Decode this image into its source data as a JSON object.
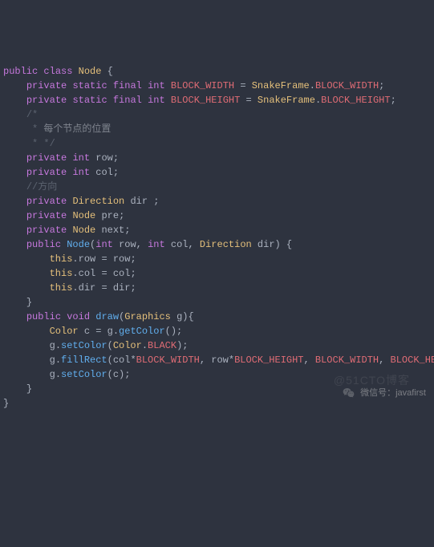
{
  "code": {
    "tokens": [
      [
        [
          "kw-public",
          "public"
        ],
        [
          "space",
          " "
        ],
        [
          "kw-class",
          "class"
        ],
        [
          "space",
          " "
        ],
        [
          "class-name",
          "Node"
        ],
        [
          "space",
          " "
        ],
        [
          "punct",
          "{"
        ]
      ],
      [
        [
          "space",
          ""
        ]
      ],
      [
        [
          "indent",
          "    "
        ],
        [
          "kw-private",
          "private"
        ],
        [
          "space",
          " "
        ],
        [
          "kw-static",
          "static"
        ],
        [
          "space",
          " "
        ],
        [
          "kw-final",
          "final"
        ],
        [
          "space",
          " "
        ],
        [
          "kw-int",
          "int"
        ],
        [
          "space",
          " "
        ],
        [
          "field-name",
          "BLOCK_WIDTH"
        ],
        [
          "space",
          " "
        ],
        [
          "punct",
          "="
        ],
        [
          "space",
          " "
        ],
        [
          "class-name",
          "SnakeFrame"
        ],
        [
          "punct",
          "."
        ],
        [
          "field-name",
          "BLOCK_WIDTH"
        ],
        [
          "punct",
          ";"
        ]
      ],
      [
        [
          "indent",
          "    "
        ],
        [
          "kw-private",
          "private"
        ],
        [
          "space",
          " "
        ],
        [
          "kw-static",
          "static"
        ],
        [
          "space",
          " "
        ],
        [
          "kw-final",
          "final"
        ],
        [
          "space",
          " "
        ],
        [
          "kw-int",
          "int"
        ],
        [
          "space",
          " "
        ],
        [
          "field-name",
          "BLOCK_HEIGHT"
        ],
        [
          "space",
          " "
        ],
        [
          "punct",
          "="
        ],
        [
          "space",
          " "
        ],
        [
          "class-name",
          "SnakeFrame"
        ],
        [
          "punct",
          "."
        ],
        [
          "field-name",
          "BLOCK_HEIGHT"
        ],
        [
          "punct",
          ";"
        ]
      ],
      [
        [
          "indent",
          "    "
        ],
        [
          "comment",
          "/*"
        ]
      ],
      [
        [
          "indent",
          "     "
        ],
        [
          "comment",
          "* "
        ],
        [
          "comment-cn",
          "每个节点的位置"
        ]
      ],
      [
        [
          "indent",
          "     "
        ],
        [
          "comment",
          "* */"
        ]
      ],
      [
        [
          "indent",
          "    "
        ],
        [
          "kw-private",
          "private"
        ],
        [
          "space",
          " "
        ],
        [
          "kw-int",
          "int"
        ],
        [
          "space",
          " "
        ],
        [
          "ident",
          "row"
        ],
        [
          "punct",
          ";"
        ]
      ],
      [
        [
          "indent",
          "    "
        ],
        [
          "kw-private",
          "private"
        ],
        [
          "space",
          " "
        ],
        [
          "kw-int",
          "int"
        ],
        [
          "space",
          " "
        ],
        [
          "ident",
          "col"
        ],
        [
          "punct",
          ";"
        ]
      ],
      [
        [
          "indent",
          "    "
        ],
        [
          "comment",
          "//方向"
        ]
      ],
      [
        [
          "indent",
          "    "
        ],
        [
          "kw-private",
          "private"
        ],
        [
          "space",
          " "
        ],
        [
          "class-name",
          "Direction"
        ],
        [
          "space",
          " "
        ],
        [
          "ident",
          "dir "
        ],
        [
          "punct",
          ";"
        ]
      ],
      [
        [
          "space",
          ""
        ]
      ],
      [
        [
          "indent",
          "    "
        ],
        [
          "kw-private",
          "private"
        ],
        [
          "space",
          " "
        ],
        [
          "class-name",
          "Node"
        ],
        [
          "space",
          " "
        ],
        [
          "ident",
          "pre"
        ],
        [
          "punct",
          ";"
        ]
      ],
      [
        [
          "indent",
          "    "
        ],
        [
          "kw-private",
          "private"
        ],
        [
          "space",
          " "
        ],
        [
          "class-name",
          "Node"
        ],
        [
          "space",
          " "
        ],
        [
          "ident",
          "next"
        ],
        [
          "punct",
          ";"
        ]
      ],
      [
        [
          "space",
          ""
        ]
      ],
      [
        [
          "indent",
          "    "
        ],
        [
          "kw-public",
          "public"
        ],
        [
          "space",
          " "
        ],
        [
          "method-name",
          "Node"
        ],
        [
          "punct",
          "("
        ],
        [
          "kw-int",
          "int"
        ],
        [
          "space",
          " "
        ],
        [
          "ident",
          "row"
        ],
        [
          "punct",
          ", "
        ],
        [
          "kw-int",
          "int"
        ],
        [
          "space",
          " "
        ],
        [
          "ident",
          "col"
        ],
        [
          "punct",
          ", "
        ],
        [
          "class-name",
          "Direction"
        ],
        [
          "space",
          " "
        ],
        [
          "ident",
          "dir"
        ],
        [
          "punct",
          ") {"
        ]
      ],
      [
        [
          "indent",
          "        "
        ],
        [
          "kw-this",
          "this"
        ],
        [
          "punct",
          "."
        ],
        [
          "ident",
          "row"
        ],
        [
          "space",
          " "
        ],
        [
          "punct",
          "="
        ],
        [
          "space",
          " "
        ],
        [
          "ident",
          "row"
        ],
        [
          "punct",
          ";"
        ]
      ],
      [
        [
          "indent",
          "        "
        ],
        [
          "kw-this",
          "this"
        ],
        [
          "punct",
          "."
        ],
        [
          "ident",
          "col"
        ],
        [
          "space",
          " "
        ],
        [
          "punct",
          "="
        ],
        [
          "space",
          " "
        ],
        [
          "ident",
          "col"
        ],
        [
          "punct",
          ";"
        ]
      ],
      [
        [
          "indent",
          "        "
        ],
        [
          "kw-this",
          "this"
        ],
        [
          "punct",
          "."
        ],
        [
          "ident",
          "dir"
        ],
        [
          "space",
          " "
        ],
        [
          "punct",
          "="
        ],
        [
          "space",
          " "
        ],
        [
          "ident",
          "dir"
        ],
        [
          "punct",
          ";"
        ]
      ],
      [
        [
          "indent",
          "    "
        ],
        [
          "punct",
          "}"
        ]
      ],
      [
        [
          "space",
          ""
        ]
      ],
      [
        [
          "indent",
          "    "
        ],
        [
          "kw-public",
          "public"
        ],
        [
          "space",
          " "
        ],
        [
          "kw-void",
          "void"
        ],
        [
          "space",
          " "
        ],
        [
          "method-name",
          "draw"
        ],
        [
          "punct",
          "("
        ],
        [
          "class-name",
          "Graphics"
        ],
        [
          "space",
          " "
        ],
        [
          "ident",
          "g"
        ],
        [
          "punct",
          "){"
        ]
      ],
      [
        [
          "indent",
          "        "
        ],
        [
          "class-name",
          "Color"
        ],
        [
          "space",
          " "
        ],
        [
          "ident",
          "c"
        ],
        [
          "space",
          " "
        ],
        [
          "punct",
          "="
        ],
        [
          "space",
          " "
        ],
        [
          "ident",
          "g"
        ],
        [
          "punct",
          "."
        ],
        [
          "method-name",
          "getColor"
        ],
        [
          "punct",
          "();"
        ]
      ],
      [
        [
          "indent",
          "        "
        ],
        [
          "ident",
          "g"
        ],
        [
          "punct",
          "."
        ],
        [
          "method-name",
          "setColor"
        ],
        [
          "punct",
          "("
        ],
        [
          "class-name",
          "Color"
        ],
        [
          "punct",
          "."
        ],
        [
          "field-name",
          "BLACK"
        ],
        [
          "punct",
          ");"
        ]
      ],
      [
        [
          "indent",
          "        "
        ],
        [
          "ident",
          "g"
        ],
        [
          "punct",
          "."
        ],
        [
          "method-name",
          "fillRect"
        ],
        [
          "punct",
          "("
        ],
        [
          "ident",
          "col"
        ],
        [
          "punct",
          "*"
        ],
        [
          "field-name",
          "BLOCK_WIDTH"
        ],
        [
          "punct",
          ", "
        ],
        [
          "ident",
          "row"
        ],
        [
          "punct",
          "*"
        ],
        [
          "field-name",
          "BLOCK_HEIGHT"
        ],
        [
          "punct",
          ", "
        ],
        [
          "field-name",
          "BLOCK_WIDTH"
        ],
        [
          "punct",
          ", "
        ],
        [
          "field-name",
          "BLOCK_HEIGHT"
        ],
        [
          "punct",
          ");"
        ]
      ],
      [
        [
          "indent",
          "        "
        ],
        [
          "ident",
          "g"
        ],
        [
          "punct",
          "."
        ],
        [
          "method-name",
          "setColor"
        ],
        [
          "punct",
          "("
        ],
        [
          "ident",
          "c"
        ],
        [
          "punct",
          ");"
        ]
      ],
      [
        [
          "indent",
          "    "
        ],
        [
          "punct",
          "}"
        ]
      ],
      [
        [
          "punct",
          "}"
        ]
      ]
    ]
  },
  "watermark": {
    "label": "微信号：javafirst",
    "bg_text": "@51CTO博客"
  }
}
